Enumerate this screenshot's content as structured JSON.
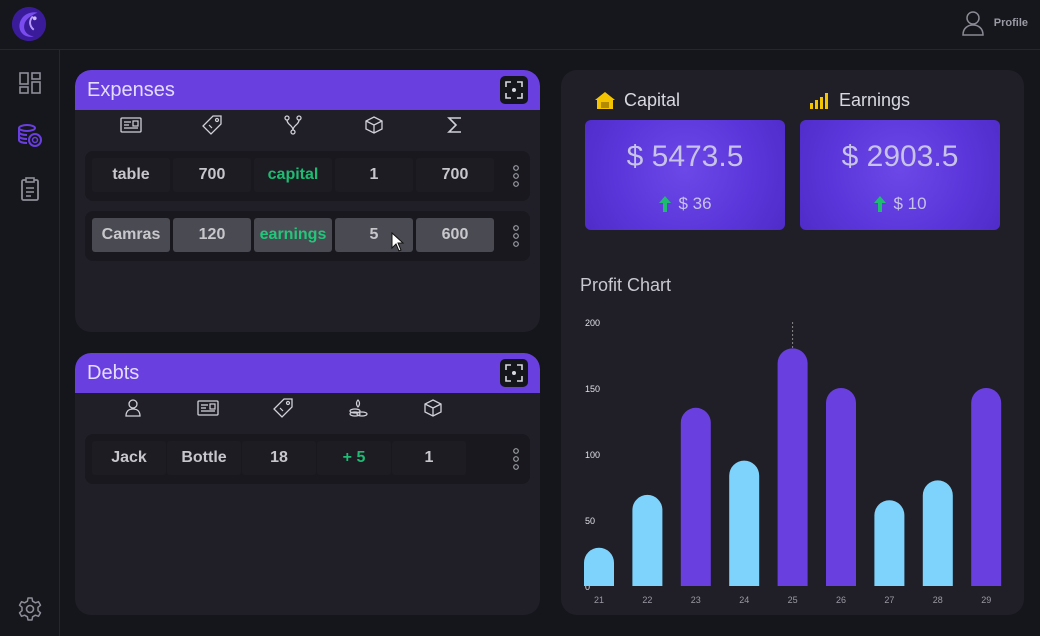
{
  "header": {
    "profile_label": "Profile"
  },
  "expenses": {
    "title": "Expenses",
    "column_icons": [
      "id-card-icon",
      "price-tag-icon",
      "branch-icon",
      "box-icon",
      "sigma-icon"
    ],
    "rows": [
      {
        "name": "table",
        "price": "700",
        "category": "capital",
        "qty": "1",
        "total": "700"
      },
      {
        "name": "Camras",
        "price": "120",
        "category": "earnings",
        "qty": "5",
        "total": "600"
      }
    ]
  },
  "debts": {
    "title": "Debts",
    "column_icons": [
      "person-icon",
      "id-card-icon",
      "price-tag-icon",
      "coins-icon",
      "box-icon"
    ],
    "rows": [
      {
        "person": "Jack",
        "item": "Bottle",
        "price": "18",
        "change": "+ 5",
        "qty": "1"
      }
    ]
  },
  "capital": {
    "title": "Capital",
    "value": "$ 5473.5",
    "delta": "$ 36",
    "accent": "#f5c400"
  },
  "earnings": {
    "title": "Earnings",
    "value": "$ 2903.5",
    "delta": "$ 10",
    "accent": "#f5c400"
  },
  "chart_data": {
    "type": "bar",
    "title": "Profit Chart",
    "categories": [
      "21",
      "22",
      "23",
      "24",
      "25",
      "26",
      "27",
      "28",
      "29"
    ],
    "values": [
      29,
      69,
      135,
      95,
      180,
      150,
      65,
      80,
      150
    ],
    "bar_colors": [
      "#7dd3fb",
      "#7dd3fb",
      "#6a3fe0",
      "#7dd3fb",
      "#6a3fe0",
      "#6a3fe0",
      "#7dd3fb",
      "#7dd3fb",
      "#6a3fe0"
    ],
    "yticks": [
      "0",
      "50",
      "100",
      "150",
      "200"
    ],
    "ylim": [
      0,
      200
    ],
    "xlabel": "",
    "ylabel": "",
    "grid": false
  }
}
